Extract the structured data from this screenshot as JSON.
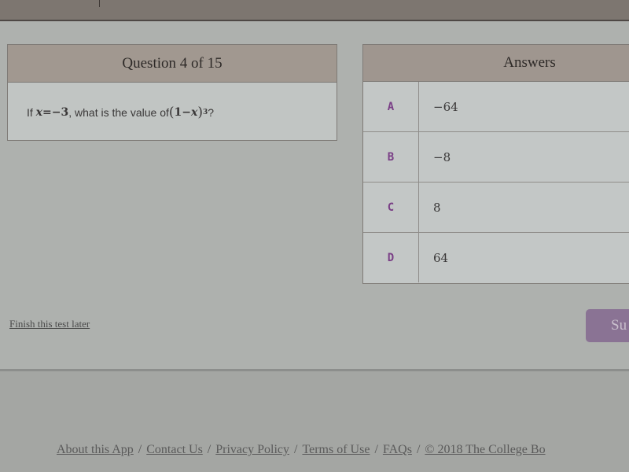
{
  "question": {
    "header": "Question 4 of 15",
    "prefix": "If ",
    "var_x": "x",
    "equals": " = ",
    "neg_value": "−3",
    "mid_text": ", what is the value of ",
    "expr_open": "(",
    "expr_one": "1",
    "expr_minus": " − ",
    "expr_var": "x",
    "expr_close": ")",
    "exponent": "3",
    "suffix": " ?"
  },
  "answers": {
    "header": "Answers",
    "options": [
      {
        "letter": "A",
        "value": "−64"
      },
      {
        "letter": "B",
        "value": "−8"
      },
      {
        "letter": "C",
        "value": "8"
      },
      {
        "letter": "D",
        "value": "64"
      }
    ]
  },
  "actions": {
    "finish_later": "Finish this test later",
    "submit": "Su"
  },
  "colors": {
    "option_letter": "#7a3f86",
    "submit_bg": "#8a7394",
    "header_bg": "#a19890"
  },
  "footer": {
    "links": [
      "About this App",
      "Contact Us",
      "Privacy Policy",
      "Terms of Use",
      "FAQs",
      "© 2018 The College Bo"
    ],
    "separator": "/"
  }
}
